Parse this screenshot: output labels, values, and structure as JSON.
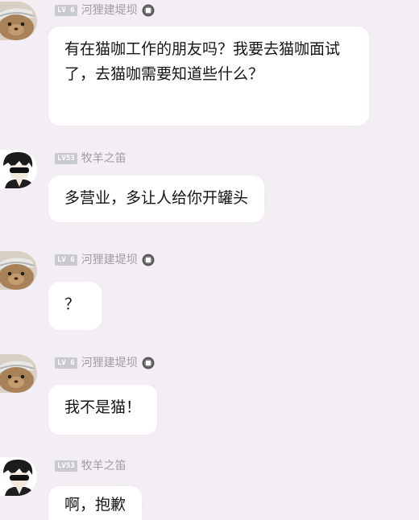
{
  "messages": [
    {
      "level": "LV 6",
      "username": "河狸建堤坝",
      "text": "有在猫咖工作的朋友吗？我要去猫咖面试了，去猫咖需要知道些什么？",
      "avatar": "cat-avatar-icon"
    },
    {
      "level": "LV53",
      "username": "牧羊之笛",
      "text": "多营业，多让人给你开罐头",
      "avatar": "anime-boy-avatar-icon"
    },
    {
      "level": "LV 6",
      "username": "河狸建堤坝",
      "text": "？",
      "avatar": "cat-avatar-icon"
    },
    {
      "level": "LV 6",
      "username": "河狸建堤坝",
      "text": "我不是猫！",
      "avatar": "cat-avatar-icon"
    },
    {
      "level": "LV53",
      "username": "牧羊之笛",
      "text": "啊，抱歉",
      "avatar": "anime-boy-avatar-icon"
    }
  ],
  "colors": {
    "background": "#f3eef3",
    "bubble": "#ffffff",
    "username": "#a39ca3",
    "level_badge": "#c9c9d2"
  }
}
